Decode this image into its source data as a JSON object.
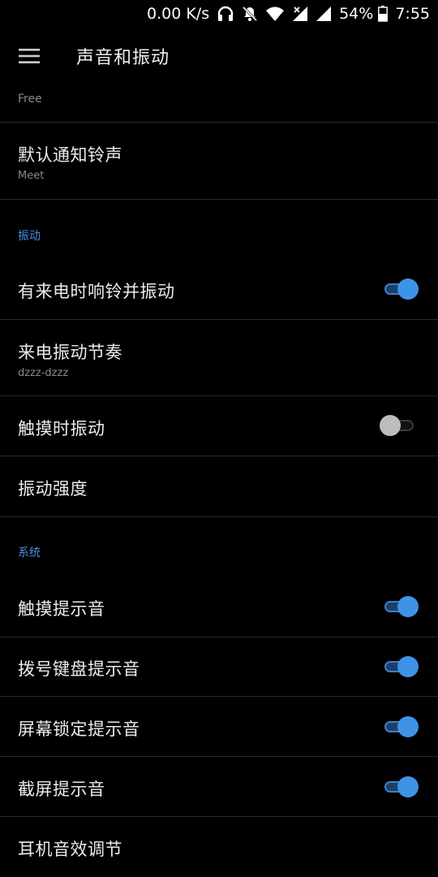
{
  "status_bar": {
    "speed": "0.00 K/s",
    "battery": "54%",
    "time": "7:55"
  },
  "app_bar": {
    "title": "声音和振动",
    "menu_icon": "hamburger-menu-icon"
  },
  "items": {
    "partial_top_subtitle": "Free",
    "default_notification": {
      "title": "默认通知铃声",
      "subtitle": "Meet"
    },
    "vibration_section": "振动",
    "ring_and_vibrate": {
      "title": "有来电时响铃并振动",
      "enabled": true
    },
    "vibration_pattern": {
      "title": "来电振动节奏",
      "subtitle": "dzzz-dzzz"
    },
    "vibrate_on_touch": {
      "title": "触摸时振动",
      "enabled": false
    },
    "vibration_intensity": {
      "title": "振动强度"
    },
    "system_section": "系统",
    "touch_sounds": {
      "title": "触摸提示音",
      "enabled": true
    },
    "dialpad_tones": {
      "title": "拨号键盘提示音",
      "enabled": true
    },
    "screen_lock_sounds": {
      "title": "屏幕锁定提示音",
      "enabled": true
    },
    "screenshot_sound": {
      "title": "截屏提示音",
      "enabled": true
    },
    "earphone_audio": {
      "title": "耳机音效调节"
    }
  },
  "colors": {
    "accent": "#3f93e6",
    "background": "#000000",
    "section_header": "#4a90e2"
  }
}
